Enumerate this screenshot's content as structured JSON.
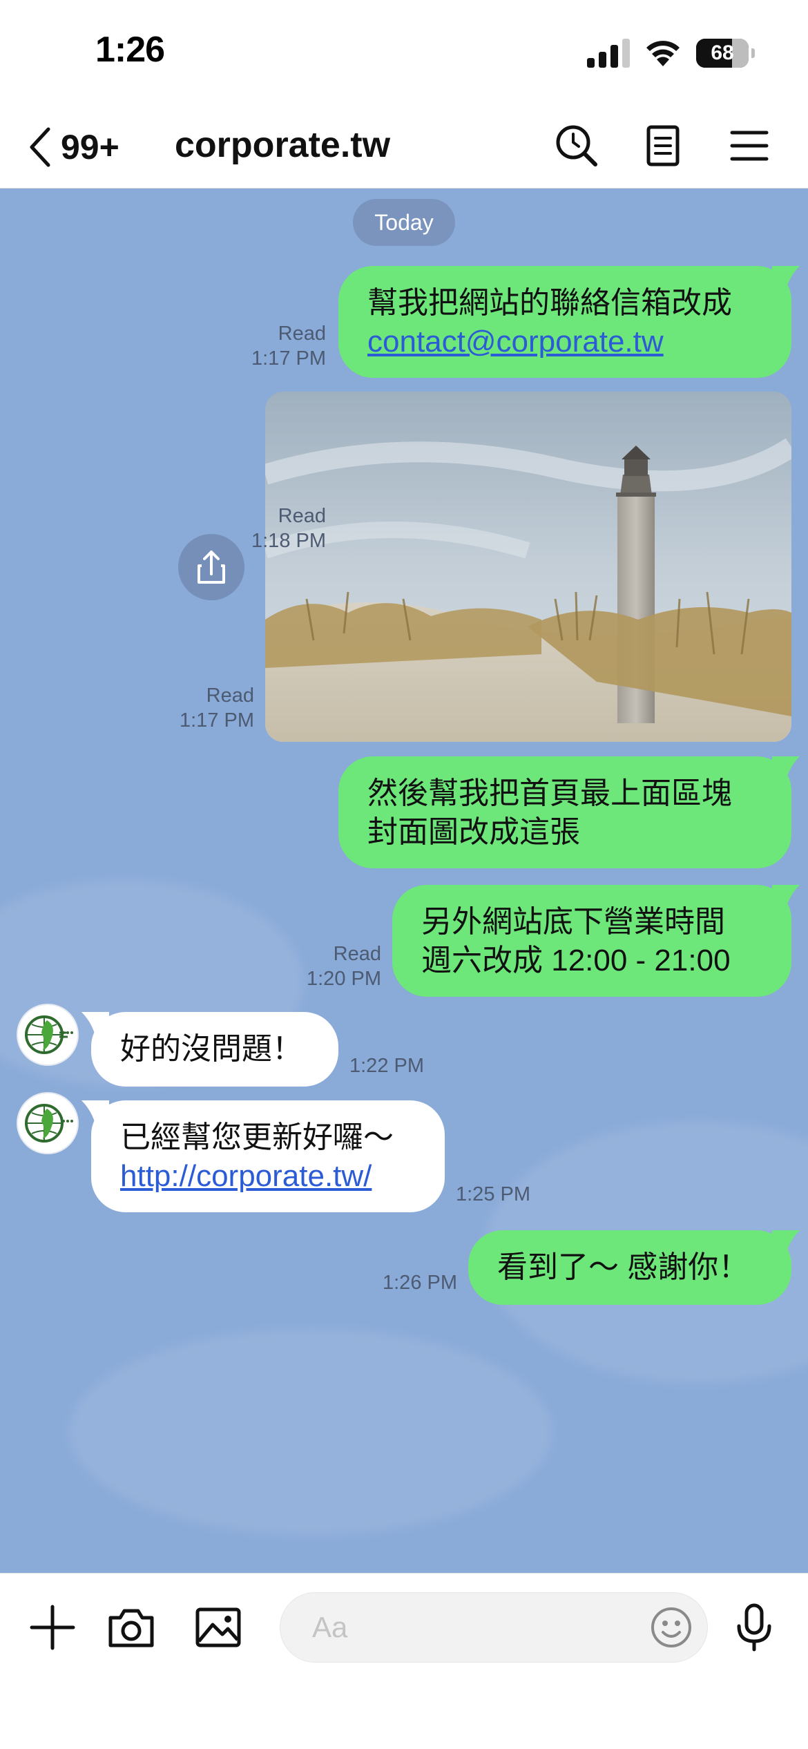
{
  "status_bar": {
    "time": "1:26",
    "battery": "68",
    "battery_level": 0.68
  },
  "nav": {
    "back_count": "99+",
    "title": "corporate.tw"
  },
  "chat": {
    "date_chip": "Today",
    "messages": [
      {
        "line1": "幫我把網站的聯絡信箱改成",
        "link": "contact@corporate.tw",
        "status": "Read",
        "time": "1:17 PM"
      },
      {
        "status": "Read",
        "time": "1:17 PM"
      },
      {
        "line1": "然後幫我把首頁最上面區塊",
        "line2": "封面圖改成這張",
        "status": "Read",
        "time": "1:18 PM"
      },
      {
        "line1": "另外網站底下營業時間",
        "line2": "週六改成 12:00 - 21:00",
        "status": "Read",
        "time": "1:20 PM"
      },
      {
        "line1": "好的沒問題！",
        "time": "1:22 PM"
      },
      {
        "line1": "已經幫您更新好囉～",
        "link": "http://corporate.tw/",
        "time": "1:25 PM"
      },
      {
        "line1": "看到了～ 感謝你！",
        "time": "1:26 PM"
      }
    ]
  },
  "input": {
    "placeholder": "Aa"
  },
  "colors": {
    "chat_bg": "#8aaad8",
    "sent_bubble": "#6de67a",
    "recv_bubble": "#ffffff",
    "link": "#2c5bd6"
  },
  "icons": [
    "chevron-left-icon",
    "search-icon",
    "notes-icon",
    "menu-icon",
    "share-icon",
    "plus-icon",
    "camera-icon",
    "image-icon",
    "emoji-icon",
    "microphone-icon",
    "signal-icon",
    "wifi-icon"
  ]
}
